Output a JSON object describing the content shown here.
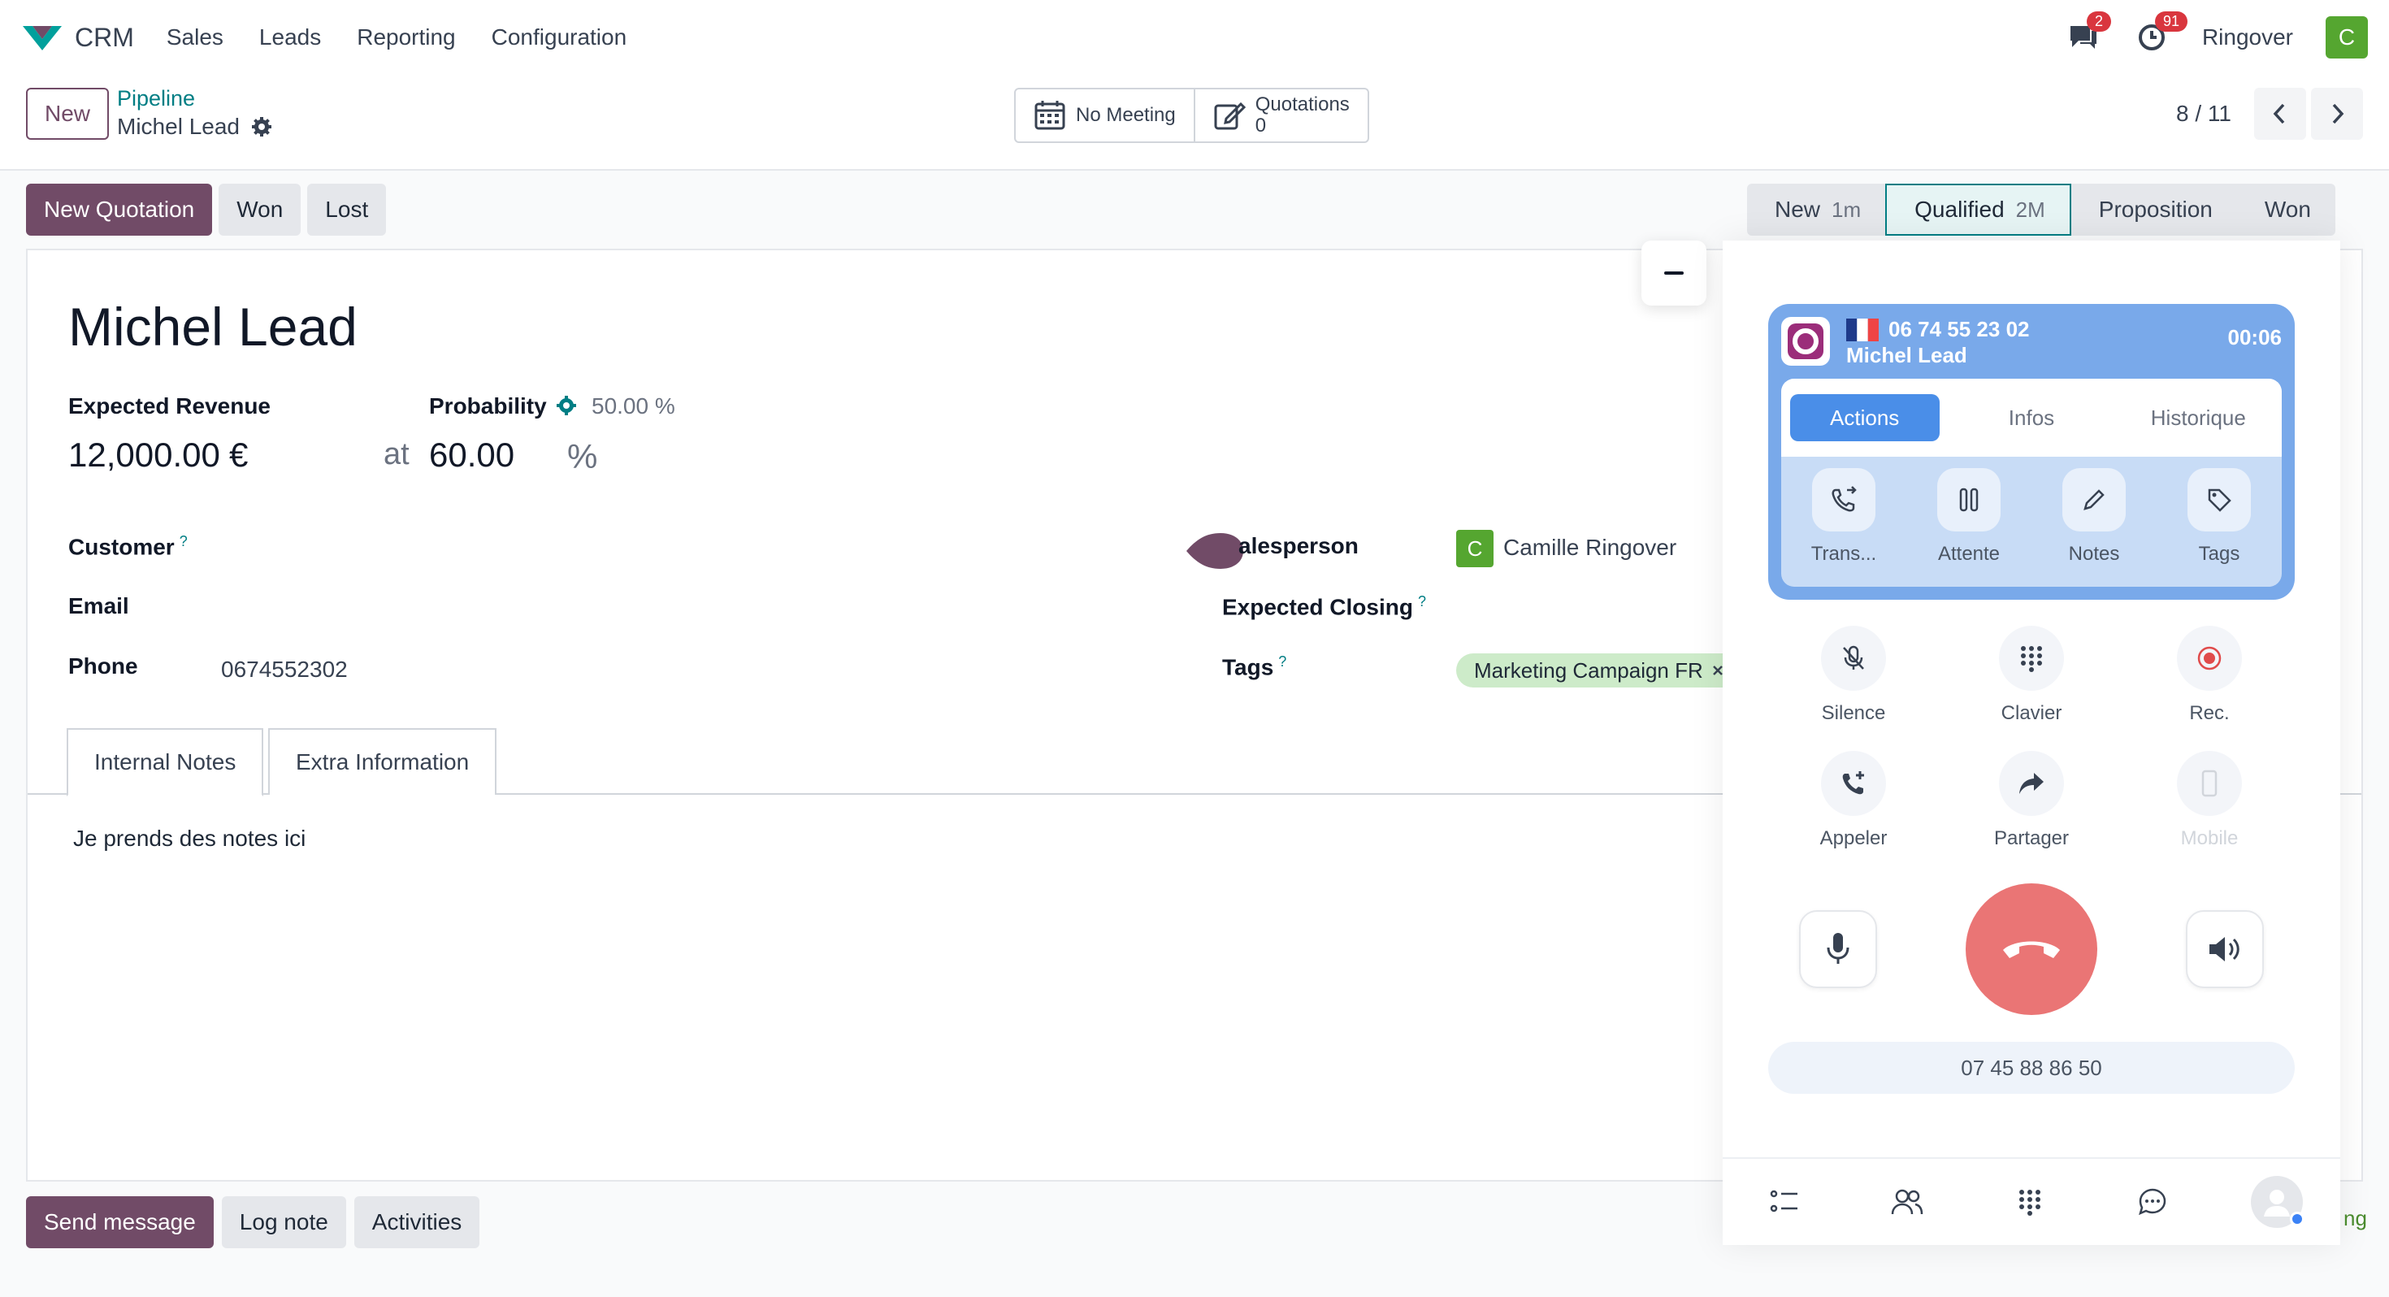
{
  "navbar": {
    "app_name": "CRM",
    "menu": [
      "Sales",
      "Leads",
      "Reporting",
      "Configuration"
    ],
    "messages_badge": "2",
    "activities_badge": "91",
    "company": "Ringover",
    "user_initial": "C",
    "brand_color": "#714b67"
  },
  "control": {
    "new_label": "New",
    "breadcrumb_parent": "Pipeline",
    "breadcrumb_current": "Michel Lead",
    "smart_meeting": "No Meeting",
    "smart_quotations_label": "Quotations",
    "smart_quotations_count": "0",
    "pager": "8 / 11"
  },
  "actions": {
    "new_quotation": "New Quotation",
    "won": "Won",
    "lost": "Lost"
  },
  "stages": [
    {
      "name": "New",
      "duration": "1m"
    },
    {
      "name": "Qualified",
      "duration": "2M"
    },
    {
      "name": "Proposition",
      "duration": ""
    },
    {
      "name": "Won",
      "duration": ""
    }
  ],
  "form": {
    "title": "Michel Lead",
    "expected_revenue_label": "Expected Revenue",
    "expected_revenue": "12,000.00",
    "currency": "€",
    "probability_label": "Probability",
    "probability_auto": "50.00 %",
    "at_label": "at",
    "probability": "60.00",
    "percent": "%",
    "customer_label": "Customer",
    "email_label": "Email",
    "phone_label": "Phone",
    "phone": "0674552302",
    "salesperson_label": "alesperson",
    "salesperson_initial": "C",
    "salesperson": "Camille Ringover",
    "expected_closing_label": "Expected Closing",
    "tags_label": "Tags",
    "tag": "Marketing Campaign FR",
    "help_mark": "?"
  },
  "tabs": [
    "Internal Notes",
    "Extra Information"
  ],
  "notes": "Je prends des notes ici",
  "chatter": {
    "send_message": "Send message",
    "log_note": "Log note",
    "activities": "Activities"
  },
  "phone_widget": {
    "call_number": "06 74 55 23 02",
    "call_name": "Michel Lead",
    "timer": "00:06",
    "tabs": [
      "Actions",
      "Infos",
      "Historique"
    ],
    "actions": [
      "Trans...",
      "Attente",
      "Notes",
      "Tags"
    ],
    "controls_row1": [
      "Silence",
      "Clavier",
      "Rec."
    ],
    "controls_row2": [
      "Appeler",
      "Partager",
      "Mobile"
    ],
    "my_number": "07 45 88 86 50",
    "accent": "#79a9ea",
    "hangup_color": "#ea7575",
    "peek_text": "ng"
  }
}
